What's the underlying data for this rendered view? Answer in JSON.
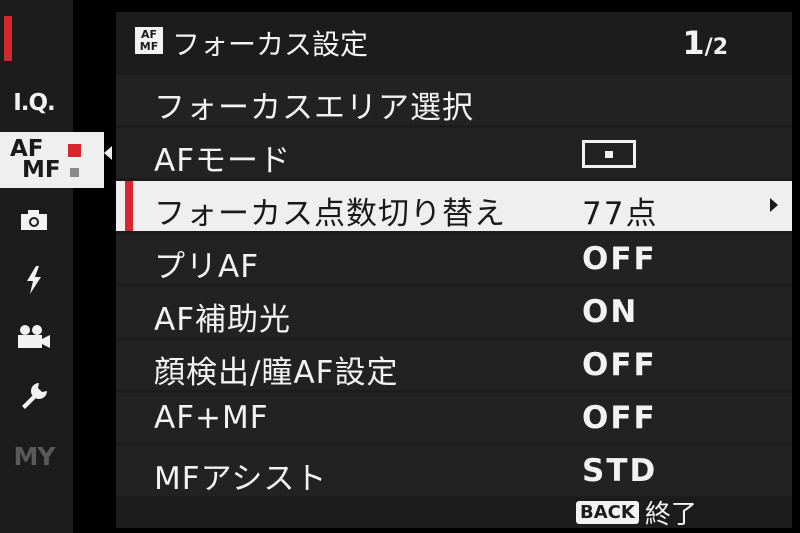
{
  "sidebar": {
    "items": [
      {
        "name": "image-quality",
        "label": "I.Q."
      },
      {
        "name": "af-mf",
        "label_top": "AF",
        "label_bottom": "MF"
      },
      {
        "name": "shooting",
        "icon": "camera-icon"
      },
      {
        "name": "flash",
        "icon": "flash-icon"
      },
      {
        "name": "movie",
        "icon": "movie-camera-icon"
      },
      {
        "name": "setup",
        "icon": "wrench-icon"
      },
      {
        "name": "my-menu",
        "label": "MY"
      }
    ],
    "active_index": 1,
    "accent_color": "#d7262e"
  },
  "header": {
    "badge_top": "AF",
    "badge_bottom": "MF",
    "title": "フォーカス設定",
    "page_current": "1",
    "page_total": "/2"
  },
  "menu": {
    "rows": [
      {
        "label": "フォーカスエリア選択",
        "value": ""
      },
      {
        "label": "AFモード",
        "value": "",
        "icon": "single-point-af-icon"
      },
      {
        "label": "フォーカス点数切り替え",
        "value": "77点",
        "selected": true
      },
      {
        "label": "プリAF",
        "value": "OFF"
      },
      {
        "label": "AF補助光",
        "value": "ON"
      },
      {
        "label": "顔検出/瞳AF設定",
        "value": "OFF"
      },
      {
        "label": "AF+MF",
        "value": "OFF"
      },
      {
        "label": "MFアシスト",
        "value": "STD"
      }
    ]
  },
  "footer": {
    "back_button": "BACK",
    "back_label": "終了"
  }
}
